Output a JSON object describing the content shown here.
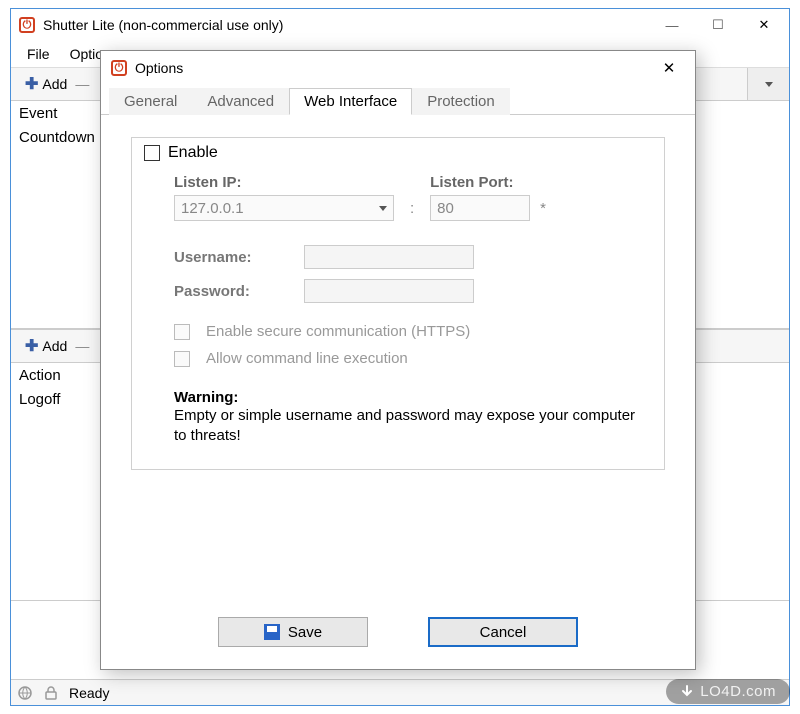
{
  "main": {
    "title": "Shutter Lite (non-commercial use only)",
    "menu": [
      "File",
      "Options"
    ],
    "section1": {
      "add_label": "Add",
      "col1": "Event",
      "row1": "Countdown"
    },
    "section2": {
      "add_label": "Add",
      "col1": "Action",
      "row1": "Logoff"
    },
    "status": "Ready"
  },
  "dialog": {
    "title": "Options",
    "tabs": [
      "General",
      "Advanced",
      "Web Interface",
      "Protection"
    ],
    "active_tab": 2,
    "enable_label": "Enable",
    "listen_ip_label": "Listen IP:",
    "listen_ip_value": "127.0.0.1",
    "listen_port_label": "Listen Port:",
    "listen_port_value": "80",
    "username_label": "Username:",
    "password_label": "Password:",
    "https_label": "Enable secure communication (HTTPS)",
    "cmdline_label": "Allow command line execution",
    "warning_head": "Warning:",
    "warning_body": "Empty or simple username and password may expose your computer to threats!",
    "save_label": "Save",
    "cancel_label": "Cancel"
  },
  "watermark": "LO4D.com"
}
